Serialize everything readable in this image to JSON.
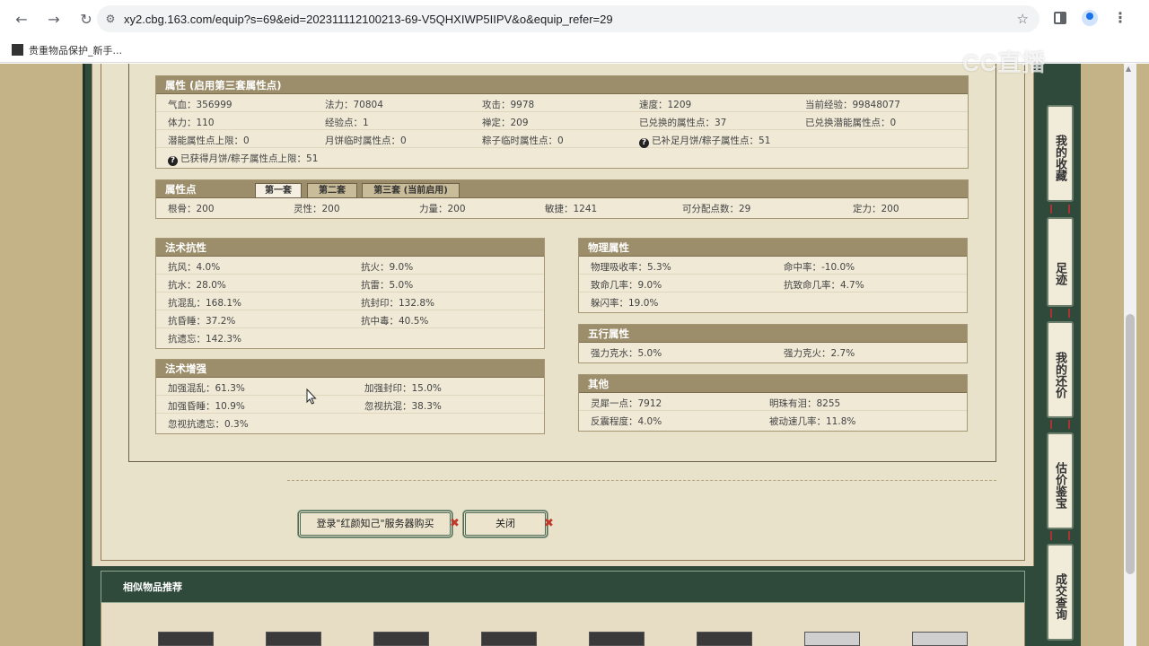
{
  "browser": {
    "url": "xy2.cbg.163.com/equip?s=69&eid=202311112100213-69-V5QHXIWP5IIPV&o&equip_refer=29",
    "bookmark_label": "贵重物品保护_新手...",
    "watermark": "CC直播"
  },
  "attributes": {
    "title": "属性 (启用第三套属性点)",
    "rows": [
      [
        "气血：356999",
        "法力：70804",
        "攻击：9978",
        "速度：1209",
        "当前经验：99848077"
      ],
      [
        "体力：110",
        "经验点：1",
        "禅定：209",
        "已兑换的属性点：37",
        "已兑换潜能属性点：0"
      ],
      [
        "潜能属性点上限：0",
        "月饼临时属性点：0",
        "粽子临时属性点：0",
        "已补足月饼/粽子属性点：51"
      ]
    ],
    "last_row": "已获得月饼/粽子属性点上限：51"
  },
  "points": {
    "title": "属性点",
    "tabs": [
      "第一套",
      "第二套",
      "第三套 (当前启用)"
    ],
    "values": [
      "根骨：200",
      "灵性：200",
      "力量：200",
      "敏捷：1241",
      "可分配点数：29",
      "定力：200"
    ]
  },
  "resist": {
    "title": "法术抗性",
    "items": [
      "抗风：4.0%",
      "抗火：9.0%",
      "抗水：28.0%",
      "抗雷：5.0%",
      "抗混乱：168.1%",
      "抗封印：132.8%",
      "抗昏睡：37.2%",
      "抗中毒：40.5%",
      "抗遗忘：142.3%"
    ]
  },
  "enhance": {
    "title": "法术增强",
    "items": [
      "加强混乱：61.3%",
      "加强封印：15.0%",
      "加强昏睡：10.9%",
      "忽视抗混：38.3%",
      "忽视抗遗忘：0.3%"
    ]
  },
  "physical": {
    "title": "物理属性",
    "items": [
      "物理吸收率：5.3%",
      "命中率：-10.0%",
      "致命几率：9.0%",
      "抗致命几率：4.7%",
      "躲闪率：19.0%"
    ]
  },
  "elements": {
    "title": "五行属性",
    "items": [
      "强力克水：5.0%",
      "强力克火：2.7%"
    ]
  },
  "other": {
    "title": "其他",
    "items": [
      "灵犀一点：7912",
      "明珠有泪：8255",
      "反震程度：4.0%",
      "被动速几率：11.8%"
    ]
  },
  "buttons": {
    "buy": "登录\"红颜知己\"服务器购买",
    "close": "关闭"
  },
  "similar": {
    "title": "相似物品推荐"
  },
  "side_tabs": [
    "我的收藏",
    "足迹",
    "我的还价",
    "估价鉴宝",
    "成交查询"
  ]
}
